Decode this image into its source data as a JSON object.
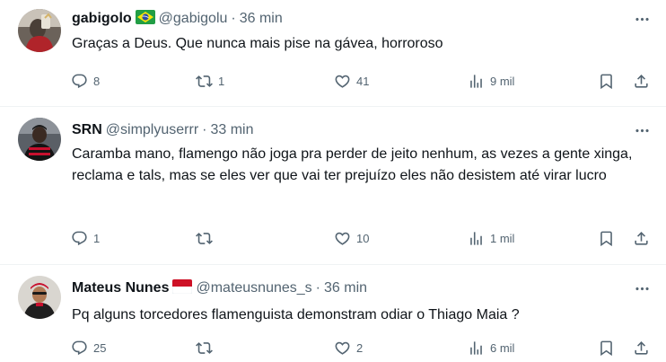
{
  "tweets": [
    {
      "name": "gabigolo",
      "has_flag": "brazil",
      "handle": "@gabigolu",
      "time": "36 min",
      "text": "Graças a Deus. Que nunca mais pise na gávea, horroroso",
      "replies": "8",
      "retweets": "1",
      "likes": "41",
      "views": "9 mil"
    },
    {
      "name": "SRN",
      "handle": "@simplyuserrr",
      "time": "33 min",
      "text": "Caramba mano, flamengo não joga pra perder de jeito nenhum,  as vezes a gente xinga, reclama e tals, mas se eles ver que vai ter prejuízo eles não desistem até virar lucro",
      "replies": "1",
      "retweets": "",
      "likes": "10",
      "views": "1 mil"
    },
    {
      "name": "Mateus Nunes",
      "has_flag": "indonesia-monaco",
      "handle": "@mateusnunes_s",
      "time": "36 min",
      "text": "Pq alguns torcedores flamenguista demonstram odiar o Thiago Maia ?",
      "replies": "25",
      "retweets": "",
      "likes": "2",
      "views": "6 mil"
    }
  ],
  "separator": "·",
  "icons": {
    "reply": "reply-icon",
    "retweet": "retweet-icon",
    "like": "heart-icon",
    "views": "views-icon",
    "bookmark": "bookmark-icon",
    "share": "share-icon",
    "more": "more-icon"
  },
  "colors": {
    "text": "#0f1419",
    "secondary": "#536471",
    "divider": "#eff3f4",
    "flag_green": "#229e45",
    "flag_yellow": "#f8e509",
    "flag_blue": "#2b49a3",
    "flag_red": "#ce1126"
  }
}
